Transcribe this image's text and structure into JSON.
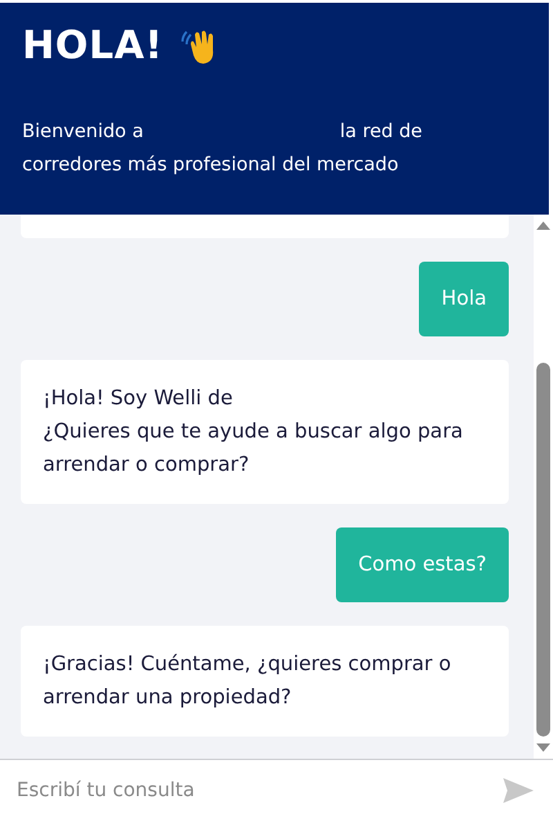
{
  "header": {
    "title": "HOLA!",
    "intro_start": "Bienvenido a",
    "intro_end": "la red de corredores más profesional del mercado"
  },
  "messages": [
    {
      "kind": "clipped"
    },
    {
      "kind": "user",
      "text": "Hola"
    },
    {
      "kind": "bot",
      "text": "¡Hola! Soy Welli de\n¿Quieres que te ayude a buscar algo para arrendar o comprar?"
    },
    {
      "kind": "user",
      "text": "Como estas?"
    },
    {
      "kind": "bot",
      "text": "¡Gracias! Cuéntame, ¿quieres comprar o arrendar una propiedad?"
    }
  ],
  "composer": {
    "placeholder": "Escribí tu consulta"
  }
}
